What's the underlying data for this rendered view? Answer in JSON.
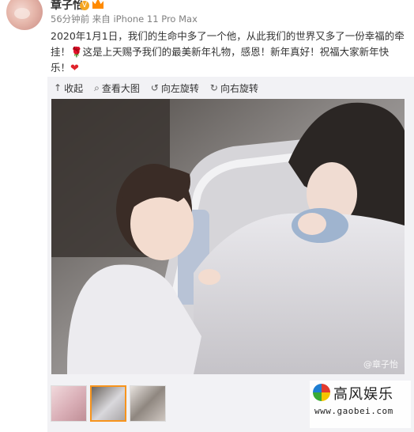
{
  "post": {
    "user_name": "章子怡",
    "meta": "56分钟前 来自 iPhone 11 Pro Max",
    "text_part1": "2020年1月1日，我们的生命中多了一个他，从此我们的世界又多了一份幸福的牵挂！",
    "rose_emoji": "🌹",
    "text_part2": "这是上天赐予我们的最美新年礼物，感恩！新年真好！祝福大家新年快乐！",
    "heart_emoji": "❤"
  },
  "toolbar": {
    "collapse": "收起",
    "view_large": "查看大图",
    "rotate_left": "向左旋转",
    "rotate_right": "向右旋转"
  },
  "photo": {
    "watermark": "@章子怡"
  },
  "thumbnails": {
    "count": 3,
    "selected": 2
  },
  "brand": {
    "name": "高风娱乐",
    "url": "www.gaobei.com"
  },
  "colors": {
    "accent_orange": "#f7941d",
    "meta_gray": "#808080"
  }
}
